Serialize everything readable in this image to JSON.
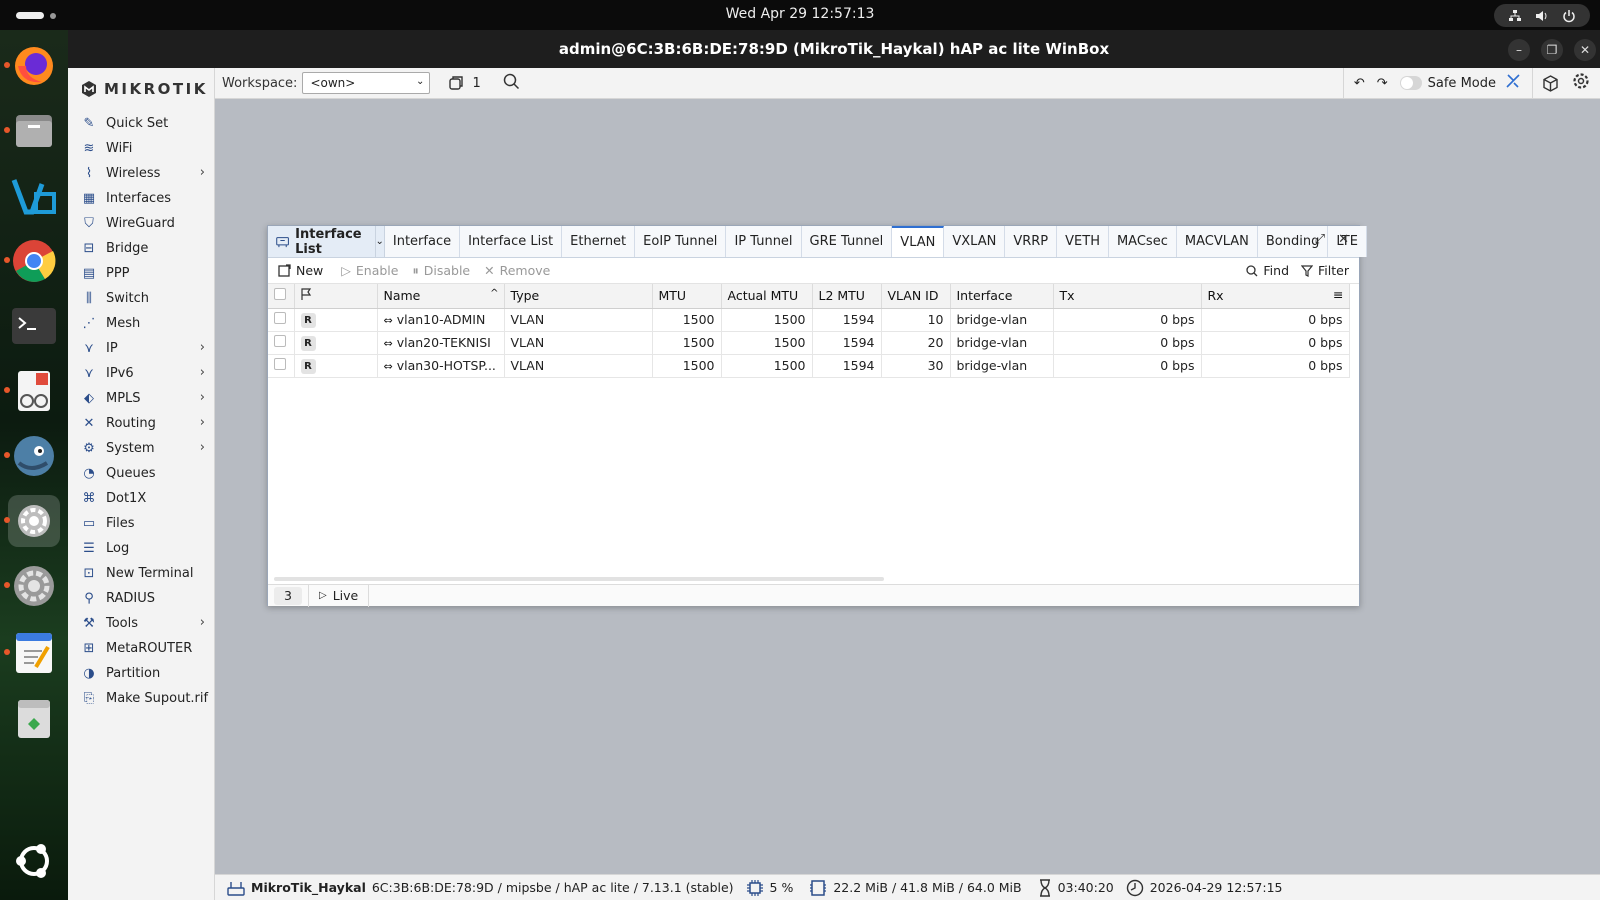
{
  "os": {
    "clock": "Wed Apr 29  12:57:13"
  },
  "window": {
    "title": "admin@6C:3B:6B:DE:78:9D (MikroTik_Haykal) hAP ac lite WinBox"
  },
  "brand": "MIKROTIK",
  "sidebar": {
    "items": [
      {
        "label": "Quick Set",
        "icon": "quick-set-icon",
        "chevron": false
      },
      {
        "label": "WiFi",
        "icon": "wifi-icon",
        "chevron": false
      },
      {
        "label": "Wireless",
        "icon": "wireless-icon",
        "chevron": true
      },
      {
        "label": "Interfaces",
        "icon": "interfaces-icon",
        "chevron": false
      },
      {
        "label": "WireGuard",
        "icon": "wireguard-icon",
        "chevron": false
      },
      {
        "label": "Bridge",
        "icon": "bridge-icon",
        "chevron": false
      },
      {
        "label": "PPP",
        "icon": "ppp-icon",
        "chevron": false
      },
      {
        "label": "Switch",
        "icon": "switch-icon",
        "chevron": false
      },
      {
        "label": "Mesh",
        "icon": "mesh-icon",
        "chevron": false
      },
      {
        "label": "IP",
        "icon": "ip-icon",
        "chevron": true
      },
      {
        "label": "IPv6",
        "icon": "ipv6-icon",
        "chevron": true
      },
      {
        "label": "MPLS",
        "icon": "mpls-icon",
        "chevron": true
      },
      {
        "label": "Routing",
        "icon": "routing-icon",
        "chevron": true
      },
      {
        "label": "System",
        "icon": "system-icon",
        "chevron": true
      },
      {
        "label": "Queues",
        "icon": "queues-icon",
        "chevron": false
      },
      {
        "label": "Dot1X",
        "icon": "dot1x-icon",
        "chevron": false
      },
      {
        "label": "Files",
        "icon": "files-icon",
        "chevron": false
      },
      {
        "label": "Log",
        "icon": "log-icon",
        "chevron": false
      },
      {
        "label": "New Terminal",
        "icon": "terminal-icon",
        "chevron": false
      },
      {
        "label": "RADIUS",
        "icon": "radius-icon",
        "chevron": false
      },
      {
        "label": "Tools",
        "icon": "tools-icon",
        "chevron": true
      },
      {
        "label": "MetaROUTER",
        "icon": "metarouter-icon",
        "chevron": false
      },
      {
        "label": "Partition",
        "icon": "partition-icon",
        "chevron": false
      },
      {
        "label": "Make Supout.rif",
        "icon": "supout-icon",
        "chevron": false
      }
    ]
  },
  "toolbar": {
    "workspace_label": "Workspace:",
    "workspace_value": "<own>",
    "window_count": "1",
    "safe_mode_label": "Safe Mode"
  },
  "dialog": {
    "title": "Interface List",
    "tabs": [
      "Interface",
      "Interface List",
      "Ethernet",
      "EoIP Tunnel",
      "IP Tunnel",
      "GRE Tunnel",
      "VLAN",
      "VXLAN",
      "VRRP",
      "VETH",
      "MACsec",
      "MACVLAN",
      "Bonding",
      "LTE"
    ],
    "active_tab": "VLAN",
    "actions": {
      "new": "New",
      "enable": "Enable",
      "disable": "Disable",
      "remove": "Remove",
      "find": "Find",
      "filter": "Filter"
    },
    "columns": [
      "Name",
      "Type",
      "MTU",
      "Actual MTU",
      "L2 MTU",
      "VLAN ID",
      "Interface",
      "Tx",
      "Rx"
    ],
    "rows": [
      {
        "flag": "R",
        "name": "vlan10-ADMIN",
        "type": "VLAN",
        "mtu": "1500",
        "actual_mtu": "1500",
        "l2_mtu": "1594",
        "vlan_id": "10",
        "interface": "bridge-vlan",
        "tx": "0 bps",
        "rx": "0 bps"
      },
      {
        "flag": "R",
        "name": "vlan20-TEKNISI",
        "type": "VLAN",
        "mtu": "1500",
        "actual_mtu": "1500",
        "l2_mtu": "1594",
        "vlan_id": "20",
        "interface": "bridge-vlan",
        "tx": "0 bps",
        "rx": "0 bps"
      },
      {
        "flag": "R",
        "name": "vlan30-HOTSP...",
        "type": "VLAN",
        "mtu": "1500",
        "actual_mtu": "1500",
        "l2_mtu": "1594",
        "vlan_id": "30",
        "interface": "bridge-vlan",
        "tx": "0 bps",
        "rx": "0 bps"
      }
    ],
    "footer": {
      "count": "3",
      "live": "Live"
    }
  },
  "statusbar": {
    "identity": "MikroTik_Haykal",
    "info": "6C:3B:6B:DE:78:9D / mipsbe / hAP ac lite / 7.13.1 (stable)",
    "cpu": "5 %",
    "memory": "22.2 MiB / 41.8 MiB / 64.0 MiB",
    "uptime": "03:40:20",
    "datetime": "2026-04-29 12:57:15"
  }
}
